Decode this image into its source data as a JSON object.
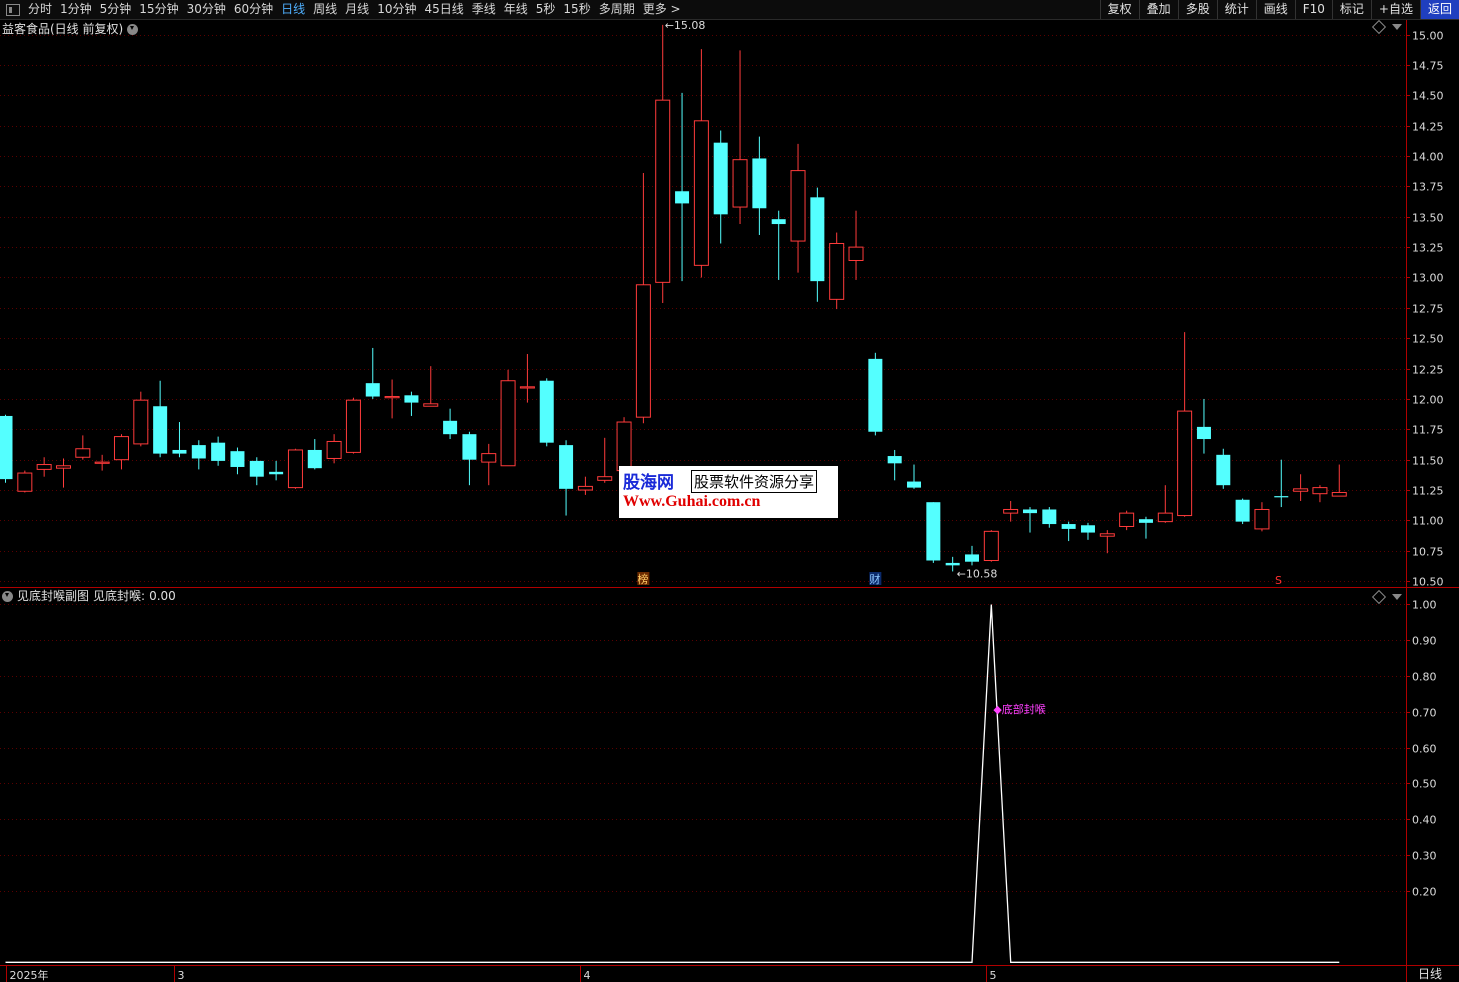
{
  "toolbar": {
    "periods": [
      "分时",
      "1分钟",
      "5分钟",
      "15分钟",
      "30分钟",
      "60分钟",
      "日线",
      "周线",
      "月线",
      "10分钟",
      "45日线",
      "季线",
      "年线",
      "5秒",
      "15秒",
      "多周期",
      "更多 >"
    ],
    "active_period": "日线",
    "right_tools": [
      "复权",
      "叠加",
      "多股",
      "统计",
      "画线",
      "F10",
      "标记",
      "+自选",
      "返回"
    ]
  },
  "stock": {
    "title": "益客食品(日线 前复权)"
  },
  "indicator": {
    "title": "见底封喉副图",
    "series_name": "见底封喉",
    "value": "0.00",
    "signal_label": "底部封喉"
  },
  "markers": {
    "bang": "榜",
    "cai": "财",
    "s": "S"
  },
  "watermark": {
    "brand": "股海网",
    "slogan": "股票软件资源分享",
    "url": "Www.Guhai.com.cn"
  },
  "period_label": "日线",
  "colors": {
    "up": "#ff3b3b",
    "down": "#54ffff",
    "grid": "#5a0000",
    "axis": "#b00000",
    "line": "#ffffff",
    "signal": "#ff40ff",
    "active": "#4fb0ff"
  },
  "chart_data": [
    {
      "type": "candlestick",
      "yticks": [
        10.5,
        10.75,
        11.0,
        11.25,
        11.5,
        11.75,
        12.0,
        12.25,
        12.5,
        12.75,
        13.0,
        13.25,
        13.5,
        13.75,
        14.0,
        14.25,
        14.5,
        14.75,
        15.0
      ],
      "ylim": [
        10.46,
        15.12
      ],
      "high_label": "15.08",
      "low_label": "10.58",
      "x_labels": [
        "2025年",
        "3",
        "4",
        "5"
      ],
      "x_label_index": [
        0,
        9,
        30,
        51
      ],
      "candles": [
        [
          11.86,
          11.34,
          11.87,
          11.31
        ],
        [
          11.24,
          11.39,
          11.41,
          11.23
        ],
        [
          11.42,
          11.46,
          11.52,
          11.36
        ],
        [
          11.43,
          11.45,
          11.51,
          11.27
        ],
        [
          11.52,
          11.59,
          11.7,
          11.5
        ],
        [
          11.47,
          11.48,
          11.54,
          11.41
        ],
        [
          11.5,
          11.69,
          11.71,
          11.42
        ],
        [
          11.63,
          11.99,
          12.06,
          11.61
        ],
        [
          11.94,
          11.55,
          12.15,
          11.52
        ],
        [
          11.58,
          11.55,
          11.81,
          11.52
        ],
        [
          11.62,
          11.51,
          11.66,
          11.42
        ],
        [
          11.64,
          11.49,
          11.69,
          11.45
        ],
        [
          11.57,
          11.44,
          11.6,
          11.38
        ],
        [
          11.49,
          11.36,
          11.52,
          11.29
        ],
        [
          11.4,
          11.38,
          11.49,
          11.33
        ],
        [
          11.27,
          11.58,
          11.59,
          11.26
        ],
        [
          11.58,
          11.43,
          11.67,
          11.42
        ],
        [
          11.51,
          11.65,
          11.71,
          11.47
        ],
        [
          11.56,
          11.99,
          12.01,
          11.55
        ],
        [
          12.13,
          12.02,
          12.42,
          12.0
        ],
        [
          12.01,
          12.02,
          12.16,
          11.84
        ],
        [
          12.03,
          11.97,
          12.06,
          11.86
        ],
        [
          11.94,
          11.96,
          12.27,
          11.95
        ],
        [
          11.82,
          11.71,
          11.92,
          11.67
        ],
        [
          11.71,
          11.5,
          11.73,
          11.29
        ],
        [
          11.48,
          11.55,
          11.63,
          11.29
        ],
        [
          11.45,
          12.15,
          12.24,
          11.45
        ],
        [
          12.09,
          12.1,
          12.37,
          11.97
        ],
        [
          12.15,
          11.64,
          12.17,
          11.61
        ],
        [
          11.62,
          11.26,
          11.66,
          11.04
        ],
        [
          11.25,
          11.28,
          11.36,
          11.21
        ],
        [
          11.33,
          11.36,
          11.68,
          11.31
        ],
        [
          11.41,
          11.81,
          11.85,
          11.37
        ],
        [
          11.85,
          12.94,
          13.86,
          11.8
        ],
        [
          12.96,
          14.46,
          15.08,
          12.79
        ],
        [
          13.71,
          13.61,
          14.52,
          12.97
        ],
        [
          13.1,
          14.29,
          14.88,
          13.0
        ],
        [
          14.11,
          13.52,
          14.21,
          13.28
        ],
        [
          13.58,
          13.97,
          14.87,
          13.44
        ],
        [
          13.98,
          13.57,
          14.16,
          13.35
        ],
        [
          13.48,
          13.44,
          13.55,
          12.98
        ],
        [
          13.3,
          13.88,
          14.1,
          13.04
        ],
        [
          13.66,
          12.97,
          13.74,
          12.8
        ],
        [
          12.82,
          13.28,
          13.37,
          12.74
        ],
        [
          13.14,
          13.25,
          13.55,
          12.98
        ],
        [
          12.33,
          11.73,
          12.38,
          11.7
        ],
        [
          11.53,
          11.47,
          11.58,
          11.33
        ],
        [
          11.32,
          11.27,
          11.46,
          11.26
        ],
        [
          11.15,
          10.67,
          11.15,
          10.65
        ],
        [
          10.65,
          10.63,
          10.7,
          10.58
        ],
        [
          10.72,
          10.66,
          10.79,
          10.63
        ],
        [
          10.67,
          10.91,
          10.92,
          10.66
        ],
        [
          11.06,
          11.09,
          11.16,
          10.99
        ],
        [
          11.09,
          11.06,
          11.11,
          10.9
        ],
        [
          11.09,
          10.97,
          11.11,
          10.94
        ],
        [
          10.97,
          10.93,
          10.99,
          10.83
        ],
        [
          10.96,
          10.9,
          10.98,
          10.84
        ],
        [
          10.87,
          10.89,
          10.92,
          10.73
        ],
        [
          10.95,
          11.06,
          11.08,
          10.92
        ],
        [
          11.01,
          10.98,
          11.03,
          10.85
        ],
        [
          10.99,
          11.06,
          11.29,
          10.98
        ],
        [
          11.04,
          11.9,
          12.55,
          11.03
        ],
        [
          11.77,
          11.67,
          12.0,
          11.55
        ],
        [
          11.54,
          11.29,
          11.59,
          11.26
        ],
        [
          11.17,
          10.99,
          11.18,
          10.97
        ],
        [
          10.93,
          11.09,
          11.15,
          10.91
        ],
        [
          11.2,
          11.19,
          11.5,
          11.11
        ],
        [
          11.24,
          11.26,
          11.38,
          11.16
        ],
        [
          11.22,
          11.27,
          11.29,
          11.15
        ],
        [
          11.2,
          11.23,
          11.46,
          11.2
        ]
      ]
    },
    {
      "type": "line",
      "name": "见底封喉",
      "yticks": [
        0.2,
        0.3,
        0.4,
        0.5,
        0.6,
        0.7,
        0.8,
        0.9,
        1.0
      ],
      "ylim": [
        -0.0075,
        1.0405
      ],
      "values": [
        0,
        0,
        0,
        0,
        0,
        0,
        0,
        0,
        0,
        0,
        0,
        0,
        0,
        0,
        0,
        0,
        0,
        0,
        0,
        0,
        0,
        0,
        0,
        0,
        0,
        0,
        0,
        0,
        0,
        0,
        0,
        0,
        0,
        0,
        0,
        0,
        0,
        0,
        0,
        0,
        0,
        0,
        0,
        0,
        0,
        0,
        0,
        0,
        0,
        0,
        0,
        1,
        0,
        0,
        0,
        0,
        0,
        0,
        0,
        0,
        0,
        0,
        0,
        0,
        0,
        0,
        0,
        0,
        0,
        0
      ],
      "signal_index": 51
    }
  ]
}
